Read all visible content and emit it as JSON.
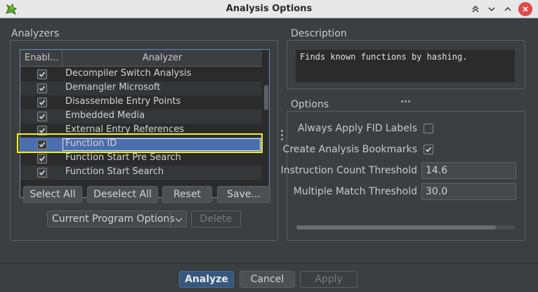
{
  "window": {
    "title": "Analysis Options"
  },
  "analyzers": {
    "title": "Analyzers",
    "columns": {
      "enabled": "Enabl...",
      "analyzer": "Analyzer"
    },
    "rows": [
      {
        "label": "Decompiler Switch Analysis",
        "checked": true
      },
      {
        "label": "Demangler Microsoft",
        "checked": true
      },
      {
        "label": "Disassemble Entry Points",
        "checked": true
      },
      {
        "label": "Embedded Media",
        "checked": true
      },
      {
        "label": "External Entry References",
        "checked": true
      },
      {
        "label": "Function ID",
        "checked": true,
        "selected": true
      },
      {
        "label": "Function Start Pre Search",
        "checked": true
      },
      {
        "label": "Function Start Search",
        "checked": true
      }
    ],
    "buttons": {
      "select_all": "Select All",
      "deselect_all": "Deselect All",
      "reset": "Reset",
      "save": "Save..."
    },
    "options_combo": "Current Program Options",
    "delete": "Delete"
  },
  "description": {
    "title": "Description",
    "text": "Finds known functions by hashing."
  },
  "options": {
    "title": "Options",
    "always_apply_fid_labels": {
      "label": "Always Apply FID Labels",
      "checked": false
    },
    "create_analysis_bookmarks": {
      "label": "Create Analysis Bookmarks",
      "checked": true
    },
    "instruction_count_threshold": {
      "label": "Instruction Count Threshold",
      "value": "14.6"
    },
    "multiple_match_threshold": {
      "label": "Multiple Match Threshold",
      "value": "30.0"
    }
  },
  "footer": {
    "analyze": "Analyze",
    "cancel": "Cancel",
    "apply": "Apply"
  },
  "colors": {
    "accent": "#365880",
    "selection": "#4b6eaf",
    "highlight": "#f2f21a",
    "close": "#e04a4a"
  }
}
